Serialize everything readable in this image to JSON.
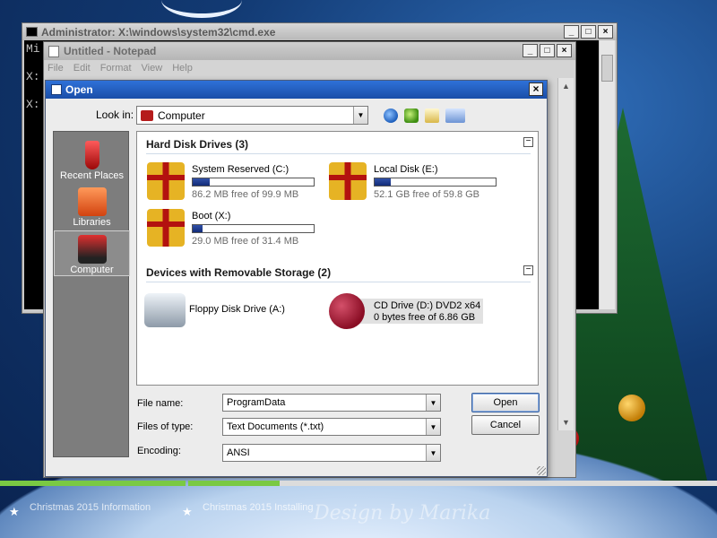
{
  "cmd": {
    "title": "Administrator: X:\\windows\\system32\\cmd.exe",
    "lines": [
      "Mi",
      "X:",
      "X:"
    ]
  },
  "notepad": {
    "title": "Untitled - Notepad",
    "menu": [
      "File",
      "Edit",
      "Format",
      "View",
      "Help"
    ]
  },
  "dialog": {
    "title": "Open",
    "look_in_label": "Look in:",
    "look_in_value": "Computer",
    "places": [
      {
        "label": "Recent Places",
        "icon": "recent-places-icon"
      },
      {
        "label": "Libraries",
        "icon": "libraries-icon"
      },
      {
        "label": "Computer",
        "icon": "computer-icon",
        "selected": true
      }
    ],
    "groups": {
      "hard_disks": {
        "title": "Hard Disk Drives (3)",
        "drives": [
          {
            "name": "System Reserved (C:)",
            "free": "86.2 MB free of 99.9 MB",
            "used_fraction": 0.14
          },
          {
            "name": "Local Disk (E:)",
            "free": "52.1 GB free of 59.8 GB",
            "used_fraction": 0.13
          },
          {
            "name": "Boot (X:)",
            "free": "29.0 MB free of 31.4 MB",
            "used_fraction": 0.08
          }
        ]
      },
      "removable": {
        "title": "Devices with Removable Storage (2)",
        "floppy": "Floppy Disk Drive (A:)",
        "cd_line1": "CD Drive (D:) DVD2 x64",
        "cd_line2": "0 bytes free of 6.86 GB"
      }
    },
    "file_name_label": "File name:",
    "file_name_value": "ProgramData",
    "file_type_label": "Files of type:",
    "file_type_value": "Text Documents (*.txt)",
    "encoding_label": "Encoding:",
    "encoding_value": "ANSI",
    "open_button": "Open",
    "cancel_button": "Cancel"
  },
  "taskbar": {
    "items": [
      "Christmas 2015 Information",
      "Christmas 2015 Installing"
    ]
  },
  "desktop": {
    "watermark": "Design by Marika"
  }
}
